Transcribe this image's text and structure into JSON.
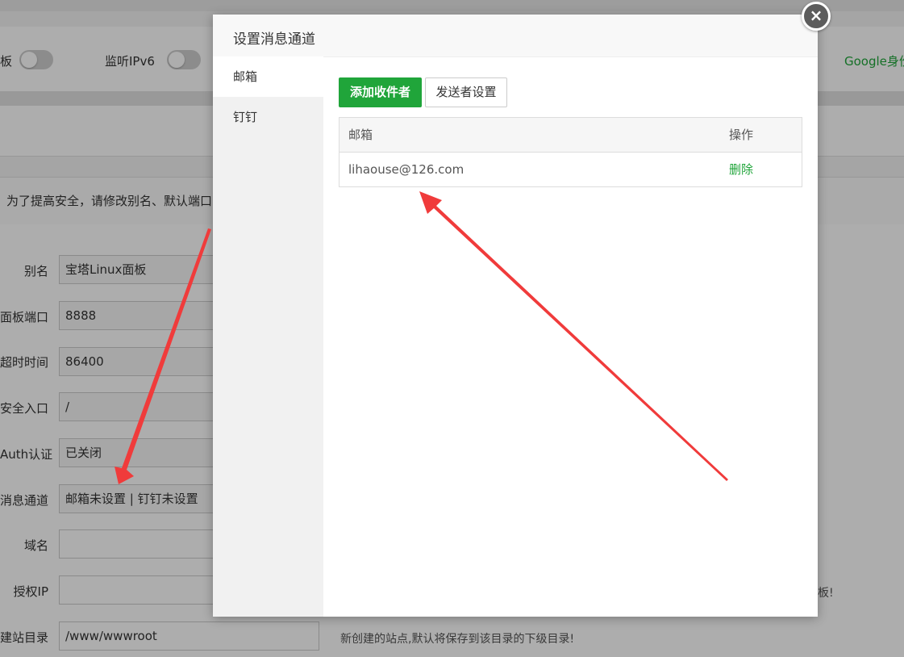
{
  "background": {
    "toggles": [
      {
        "label": "板",
        "state": "off"
      },
      {
        "label": "监听IPv6",
        "state": "off"
      }
    ],
    "google_text": "Google身份",
    "warning_text": "为了提高安全，请修改别名、默认端口",
    "form": {
      "rows": [
        {
          "label": "别名",
          "value": "宝塔Linux面板"
        },
        {
          "label": "面板端口",
          "value": "8888"
        },
        {
          "label": "超时时间",
          "value": "86400"
        },
        {
          "label": "安全入口",
          "value": "/"
        },
        {
          "label": "Auth认证",
          "value": "已关闭"
        },
        {
          "label": "消息通道",
          "value": "邮箱未设置 | 钉钉未设置"
        },
        {
          "label": "域名",
          "value": ""
        },
        {
          "label": "授权IP",
          "value": ""
        },
        {
          "label": "建站目录",
          "value": "/www/wwwroot"
        }
      ],
      "note_default_dir": "新创建的站点,默认将保存到该目录的下级目录!",
      "note_panel": "板!"
    }
  },
  "modal": {
    "title": "设置消息通道",
    "close_icon": "×",
    "tabs": [
      {
        "label": "邮箱",
        "active": true
      },
      {
        "label": "钉钉",
        "active": false
      }
    ],
    "buttons": {
      "add_recipient": "添加收件者",
      "sender_settings": "发送者设置"
    },
    "table": {
      "columns": [
        "邮箱",
        "操作"
      ],
      "rows": [
        {
          "email": "lihaouse@126.com",
          "action": "删除"
        }
      ]
    }
  },
  "colors": {
    "accent_green": "#20a53a",
    "annotation_red": "#f03b3b"
  }
}
